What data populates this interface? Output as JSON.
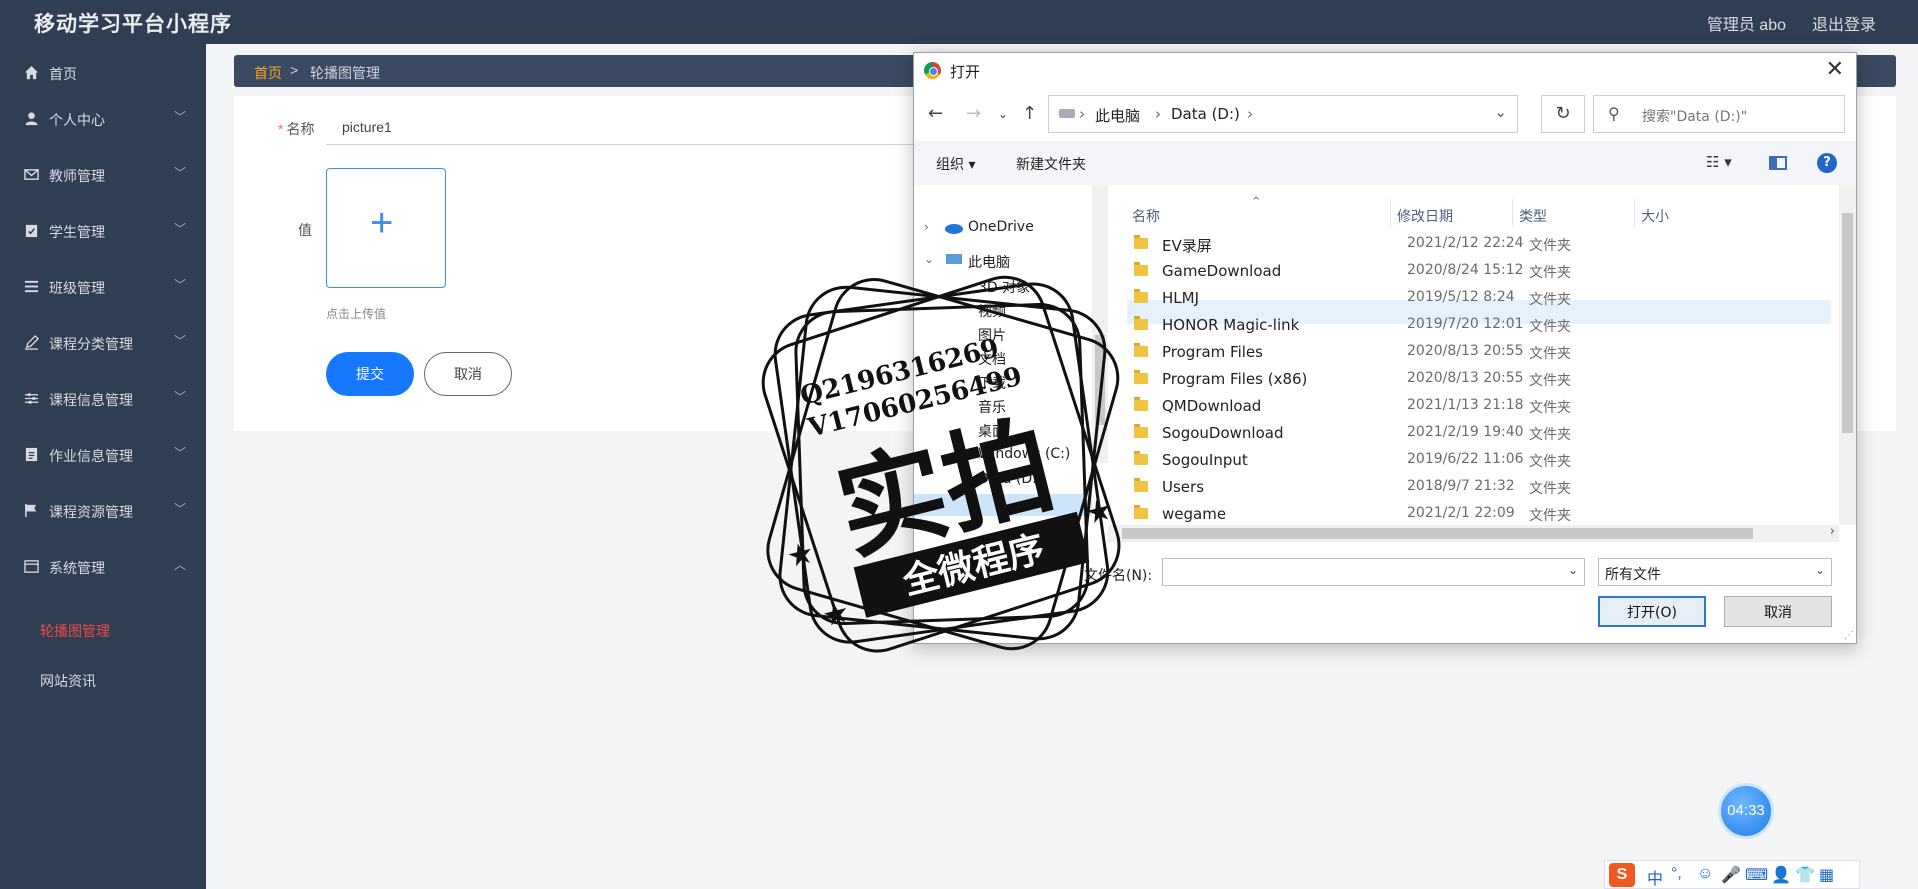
{
  "app": {
    "title": "移动学习平台小程序",
    "user": "管理员 abo",
    "logout": "退出登录"
  },
  "sidebar": {
    "items": [
      {
        "label": "首页",
        "icon": "home-icon",
        "expandable": false
      },
      {
        "label": "个人中心",
        "icon": "user-icon",
        "expandable": true
      },
      {
        "label": "教师管理",
        "icon": "mail-icon",
        "expandable": true
      },
      {
        "label": "学生管理",
        "icon": "clipboard-icon",
        "expandable": true
      },
      {
        "label": "班级管理",
        "icon": "list-icon",
        "expandable": true
      },
      {
        "label": "课程分类管理",
        "icon": "edit-icon",
        "expandable": true
      },
      {
        "label": "课程信息管理",
        "icon": "sliders-icon",
        "expandable": true
      },
      {
        "label": "作业信息管理",
        "icon": "document-icon",
        "expandable": true
      },
      {
        "label": "课程资源管理",
        "icon": "flag-icon",
        "expandable": true
      },
      {
        "label": "系统管理",
        "icon": "window-icon",
        "expandable": true,
        "expanded": true
      }
    ],
    "subitems": [
      {
        "label": "轮播图管理",
        "active": true
      },
      {
        "label": "网站资讯",
        "active": false
      }
    ]
  },
  "breadcrumb": {
    "home": "首页",
    "separator": ">",
    "current": "轮播图管理"
  },
  "form": {
    "name_label": "名称",
    "required_mark": "*",
    "name_value": "picture1",
    "value_label": "值",
    "upload_hint": "点击上传值",
    "submit": "提交",
    "cancel": "取消"
  },
  "dialog": {
    "title": "打开",
    "address": {
      "segments": [
        "此电脑",
        "Data (D:)"
      ]
    },
    "search_placeholder": "搜索\"Data (D:)\"",
    "toolbar": {
      "organize": "组织 ▾",
      "new_folder": "新建文件夹"
    },
    "tree": [
      {
        "label": "OneDrive"
      },
      {
        "label": "此电脑"
      },
      {
        "label": "3D 对象"
      },
      {
        "label": "视频"
      },
      {
        "label": "图片"
      },
      {
        "label": "文档"
      },
      {
        "label": "下载"
      },
      {
        "label": "音乐"
      },
      {
        "label": "桌面"
      },
      {
        "label": "Windows (C:)"
      },
      {
        "label": "Data (D:)",
        "selected": true
      }
    ],
    "columns": {
      "name": "名称",
      "modified": "修改日期",
      "type": "类型",
      "size": "大小"
    },
    "files": [
      {
        "name": "EV录屏",
        "date": "2021/2/12 22:24",
        "type": "文件夹"
      },
      {
        "name": "GameDownload",
        "date": "2020/8/24 15:12",
        "type": "文件夹"
      },
      {
        "name": "HLMJ",
        "date": "2019/5/12 8:24",
        "type": "文件夹"
      },
      {
        "name": "HONOR Magic-link",
        "date": "2019/7/20 12:01",
        "type": "文件夹",
        "highlighted": true
      },
      {
        "name": "Program Files",
        "date": "2020/8/13 20:55",
        "type": "文件夹"
      },
      {
        "name": "Program Files (x86)",
        "date": "2020/8/13 20:55",
        "type": "文件夹"
      },
      {
        "name": "QMDownload",
        "date": "2021/1/13 21:18",
        "type": "文件夹"
      },
      {
        "name": "SogouDownload",
        "date": "2021/2/19 19:40",
        "type": "文件夹"
      },
      {
        "name": "SogouInput",
        "date": "2019/6/22 11:06",
        "type": "文件夹"
      },
      {
        "name": "Users",
        "date": "2018/9/7 21:32",
        "type": "文件夹"
      },
      {
        "name": "wegame",
        "date": "2021/2/1 22:09",
        "type": "文件夹"
      }
    ],
    "filename_label": "文件名(N):",
    "filename_value": "",
    "filetype": "所有文件",
    "open": "打开(O)",
    "cancel": "取消"
  },
  "watermark": {
    "line1": "Q2196316269",
    "line2": "V17060256499",
    "big": "实拍",
    "banner": "全微程序"
  },
  "timer": "04:33",
  "ime": {
    "logo": "S",
    "glyphs": [
      "中",
      "°,",
      "☺",
      "🎤",
      "⌨",
      "👤",
      "👕",
      "▦"
    ]
  },
  "colors": {
    "sidebar_bg": "#2f3e52",
    "active_sub": "#f04848",
    "primary": "#1677ff",
    "breadcrumb_home": "#f5a623"
  }
}
